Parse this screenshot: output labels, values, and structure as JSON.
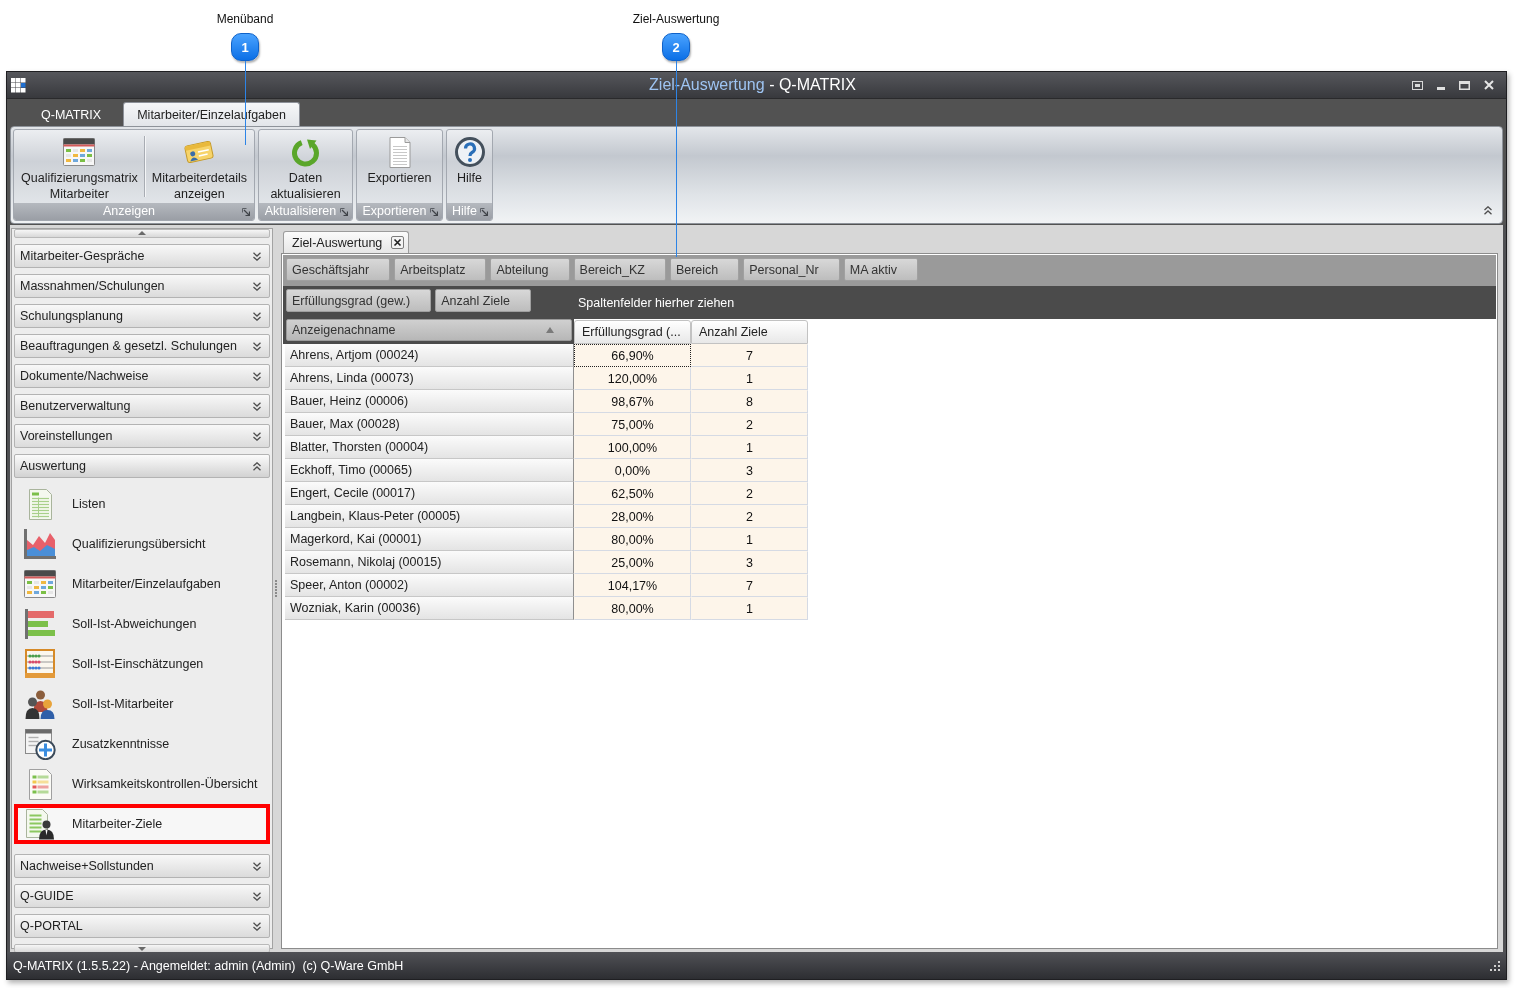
{
  "callouts": [
    {
      "number": "1",
      "label": "Menüband"
    },
    {
      "number": "2",
      "label": "Ziel-Auswertung"
    }
  ],
  "window": {
    "title": "Ziel-Auswertung",
    "separator": "-",
    "app_name": "Q-MATRIX"
  },
  "ribbon": {
    "tabs": [
      {
        "label": "Q-MATRIX",
        "selected": false
      },
      {
        "label": "Mitarbeiter/Einzelaufgaben",
        "selected": true
      }
    ],
    "groups": [
      {
        "label": "Anzeigen",
        "buttons": [
          {
            "label": "Qualifizierungsmatrix Mitarbeiter"
          },
          {
            "label": "Mitarbeiterdetails anzeigen"
          }
        ]
      },
      {
        "label": "Aktualisieren",
        "buttons": [
          {
            "label": "Daten aktualisieren"
          }
        ]
      },
      {
        "label": "Exportieren",
        "buttons": [
          {
            "label": "Exportieren"
          }
        ]
      },
      {
        "label": "Hilfe",
        "buttons": [
          {
            "label": "Hilfe"
          }
        ]
      }
    ]
  },
  "sidebar": {
    "groups": [
      {
        "label": "Mitarbeiter-Gespräche",
        "expanded": false
      },
      {
        "label": "Massnahmen/Schulungen",
        "expanded": false
      },
      {
        "label": "Schulungsplanung",
        "expanded": false
      },
      {
        "label": "Beauftragungen & gesetzl. Schulungen",
        "expanded": false
      },
      {
        "label": "Dokumente/Nachweise",
        "expanded": false
      },
      {
        "label": "Benutzerverwaltung",
        "expanded": false
      },
      {
        "label": "Voreinstellungen",
        "expanded": false
      },
      {
        "label": "Auswertung",
        "expanded": true,
        "items": [
          {
            "label": "Listen",
            "highlighted": false
          },
          {
            "label": "Qualifizierungsübersicht",
            "highlighted": false
          },
          {
            "label": "Mitarbeiter/Einzelaufgaben",
            "highlighted": false
          },
          {
            "label": "Soll-Ist-Abweichungen",
            "highlighted": false
          },
          {
            "label": "Soll-Ist-Einschätzungen",
            "highlighted": false
          },
          {
            "label": "Soll-Ist-Mitarbeiter",
            "highlighted": false
          },
          {
            "label": "Zusatzkenntnisse",
            "highlighted": false
          },
          {
            "label": "Wirksamkeitskontrollen-Übersicht",
            "highlighted": false
          },
          {
            "label": "Mitarbeiter-Ziele",
            "highlighted": true
          }
        ]
      },
      {
        "label": "Nachweise+Sollstunden",
        "expanded": false
      },
      {
        "label": "Q-GUIDE",
        "expanded": false
      },
      {
        "label": "Q-PORTAL",
        "expanded": false
      }
    ]
  },
  "document_tabs": [
    {
      "label": "Ziel-Auswertung",
      "selected": true
    }
  ],
  "pivot": {
    "filter_fields": [
      "Geschäftsjahr",
      "Arbeitsplatz",
      "Abteilung",
      "Bereich_KZ",
      "Bereich",
      "Personal_Nr",
      "MA aktiv"
    ],
    "data_fields": [
      "Erfüllungsgrad (gew.)",
      "Anzahl Ziele"
    ],
    "column_area_hint": "Spaltenfelder hierher ziehen",
    "row_field": {
      "label": "Anzeigenachname",
      "sort_ascending": true
    },
    "columns": [
      "Erfüllungsgrad (...",
      "Anzahl Ziele"
    ],
    "rows": [
      {
        "label": "Ahrens, Artjom (00024)",
        "cells": [
          {
            "text": "66,90%",
            "focused": true
          },
          {
            "text": "7",
            "focused": false
          }
        ]
      },
      {
        "label": "Ahrens, Linda (00073)",
        "cells": [
          {
            "text": "120,00%",
            "focused": false
          },
          {
            "text": "1",
            "focused": false
          }
        ]
      },
      {
        "label": "Bauer, Heinz (00006)",
        "cells": [
          {
            "text": "98,67%",
            "focused": false
          },
          {
            "text": "8",
            "focused": false
          }
        ]
      },
      {
        "label": "Bauer, Max (00028)",
        "cells": [
          {
            "text": "75,00%",
            "focused": false
          },
          {
            "text": "2",
            "focused": false
          }
        ]
      },
      {
        "label": "Blatter, Thorsten (00004)",
        "cells": [
          {
            "text": "100,00%",
            "focused": false
          },
          {
            "text": "1",
            "focused": false
          }
        ]
      },
      {
        "label": "Eckhoff, Timo (00065)",
        "cells": [
          {
            "text": "0,00%",
            "focused": false
          },
          {
            "text": "3",
            "focused": false
          }
        ]
      },
      {
        "label": "Engert, Cecile (00017)",
        "cells": [
          {
            "text": "62,50%",
            "focused": false
          },
          {
            "text": "2",
            "focused": false
          }
        ]
      },
      {
        "label": "Langbein, Klaus-Peter (00005)",
        "cells": [
          {
            "text": "28,00%",
            "focused": false
          },
          {
            "text": "2",
            "focused": false
          }
        ]
      },
      {
        "label": "Magerkord, Kai (00001)",
        "cells": [
          {
            "text": "80,00%",
            "focused": false
          },
          {
            "text": "1",
            "focused": false
          }
        ]
      },
      {
        "label": "Rosemann, Nikolaj (00015)",
        "cells": [
          {
            "text": "25,00%",
            "focused": false
          },
          {
            "text": "3",
            "focused": false
          }
        ]
      },
      {
        "label": "Speer, Anton (00002)",
        "cells": [
          {
            "text": "104,17%",
            "focused": false
          },
          {
            "text": "7",
            "focused": false
          }
        ]
      },
      {
        "label": "Wozniak, Karin (00036)",
        "cells": [
          {
            "text": "80,00%",
            "focused": false
          },
          {
            "text": "1",
            "focused": false
          }
        ]
      }
    ]
  },
  "status_bar": {
    "text": "Q-MATRIX (1.5.5.22) - Angemeldet: admin (Admin)  (c) Q-Ware GmbH"
  }
}
